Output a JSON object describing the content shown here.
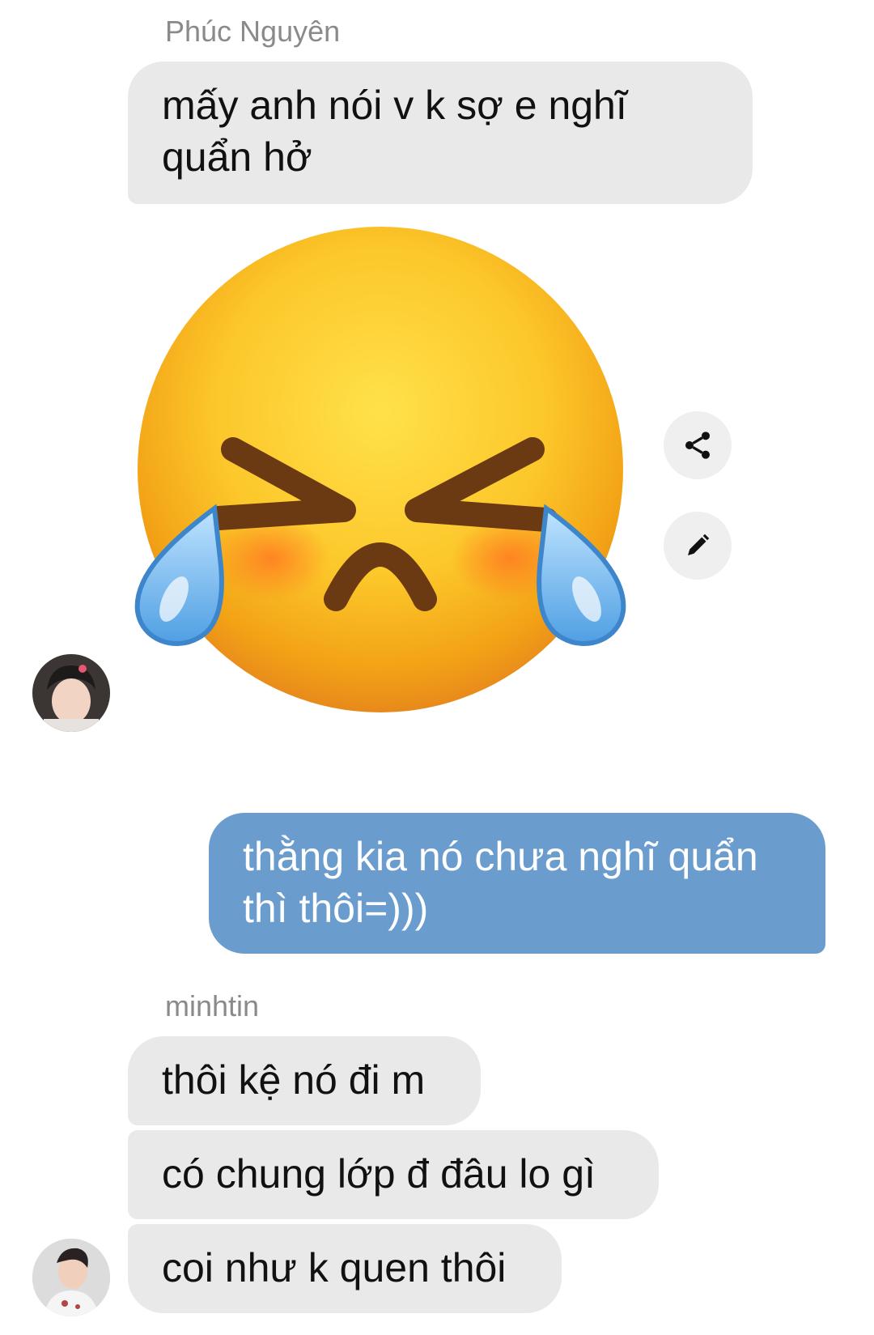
{
  "messages": {
    "group1": {
      "sender": "Phúc Nguyên",
      "text_line1": "mấy anh nói v k sợ e nghĩ",
      "text_line2": "quẩn hở",
      "sticker": "loudly-crying-face-sticker"
    },
    "outgoing": {
      "text_line1": "thằng kia nó chưa nghĩ quẩn",
      "text_line2": "thì thôi=)))"
    },
    "group2": {
      "sender": "minhtin",
      "msg1": "thôi kệ nó đi m",
      "msg2": "có chung lớp đ đâu lo gì",
      "msg3": "coi như k quen thôi"
    }
  },
  "actions": {
    "share_icon": "share-icon",
    "edit_icon": "pencil-icon"
  },
  "colors": {
    "incoming_bubble": "#e9e9e9",
    "outgoing_bubble": "#6a9ccd",
    "sender_name": "#8a8a8a"
  }
}
